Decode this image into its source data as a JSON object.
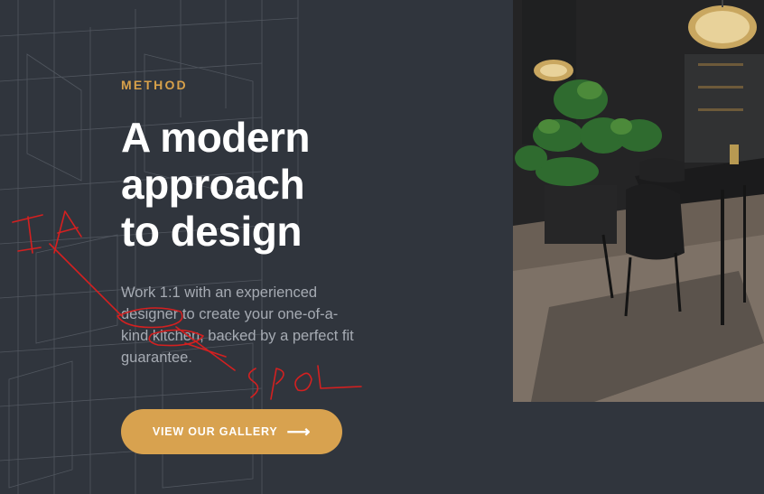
{
  "hero": {
    "eyebrow": "METHOD",
    "headline_lines": [
      "A modern",
      "approach",
      "to design"
    ],
    "body_lines": [
      "Work 1:1 with an experienced",
      "designer to create your one-of-a-",
      "kind kitchen, backed by a perfect fit",
      "guarantee."
    ],
    "cta_label": "VIEW OUR GALLERY",
    "cta_arrow": "⟶"
  },
  "annotations": {
    "handwritten_left": "IA",
    "handwritten_bottom": "SPOL"
  },
  "colors": {
    "background": "#30353d",
    "accent": "#d8a24f",
    "heading": "#ffffff",
    "body_text": "#a6abb3",
    "annotation_ink": "#d42020"
  },
  "icons": {
    "cta_icon": "arrow-right-icon"
  },
  "image": {
    "subject": "dark kitchen dining area with table, chairs, plants and pendant lamps"
  }
}
